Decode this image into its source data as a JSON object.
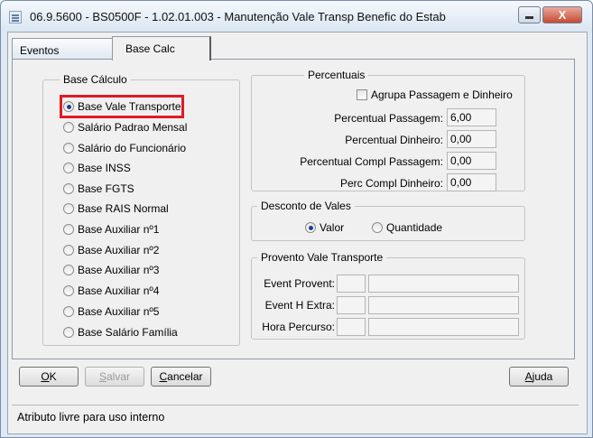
{
  "window": {
    "title": "06.9.5600 - BS0500F - 1.02.01.003 - Manutenção Vale Transp Benefic do Estab",
    "close_glyph": "X"
  },
  "tabs": [
    {
      "label": "Eventos"
    },
    {
      "label": "Base Calc"
    }
  ],
  "base_calculo": {
    "legend": "Base Cálculo",
    "options": [
      {
        "label": "Base Vale Transporte",
        "selected": true
      },
      {
        "label": "Salário Padrao Mensal",
        "selected": false
      },
      {
        "label": "Salário do Funcionário",
        "selected": false
      },
      {
        "label": "Base INSS",
        "selected": false
      },
      {
        "label": "Base FGTS",
        "selected": false
      },
      {
        "label": "Base RAIS Normal",
        "selected": false
      },
      {
        "label": "Base Auxiliar nº1",
        "selected": false
      },
      {
        "label": "Base Auxiliar nº2",
        "selected": false
      },
      {
        "label": "Base Auxiliar nº3",
        "selected": false
      },
      {
        "label": "Base Auxiliar nº4",
        "selected": false
      },
      {
        "label": "Base Auxiliar nº5",
        "selected": false
      },
      {
        "label": "Base Salário Família",
        "selected": false
      }
    ]
  },
  "percentuais": {
    "legend": "Percentuais",
    "agrupa_label": "Agrupa Passagem e Dinheiro",
    "agrupa_checked": false,
    "fields": [
      {
        "label": "Percentual Passagem:",
        "value": "6,00"
      },
      {
        "label": "Percentual Dinheiro:",
        "value": "0,00"
      },
      {
        "label": "Percentual Compl Passagem:",
        "value": "0,00"
      },
      {
        "label": "Perc Compl Dinheiro:",
        "value": "0,00"
      }
    ]
  },
  "desconto": {
    "legend": "Desconto de Vales",
    "options": [
      {
        "label": "Valor",
        "selected": true
      },
      {
        "label": "Quantidade",
        "selected": false
      }
    ]
  },
  "provento": {
    "legend": "Provento Vale Transporte",
    "fields": [
      {
        "label": "Event Provent:",
        "code": "",
        "desc": ""
      },
      {
        "label": "Event H Extra:",
        "code": "",
        "desc": ""
      },
      {
        "label": "Hora Percurso:",
        "code": "",
        "desc": ""
      }
    ]
  },
  "buttons": {
    "ok_u": "O",
    "ok_rest": "K",
    "salvar_u": "S",
    "salvar_rest": "alvar",
    "cancelar_u": "C",
    "cancelar_rest": "ancelar",
    "ajuda_u": "A",
    "ajuda_rest": "juda"
  },
  "status_bar": {
    "text": "Atributo livre para uso interno"
  }
}
